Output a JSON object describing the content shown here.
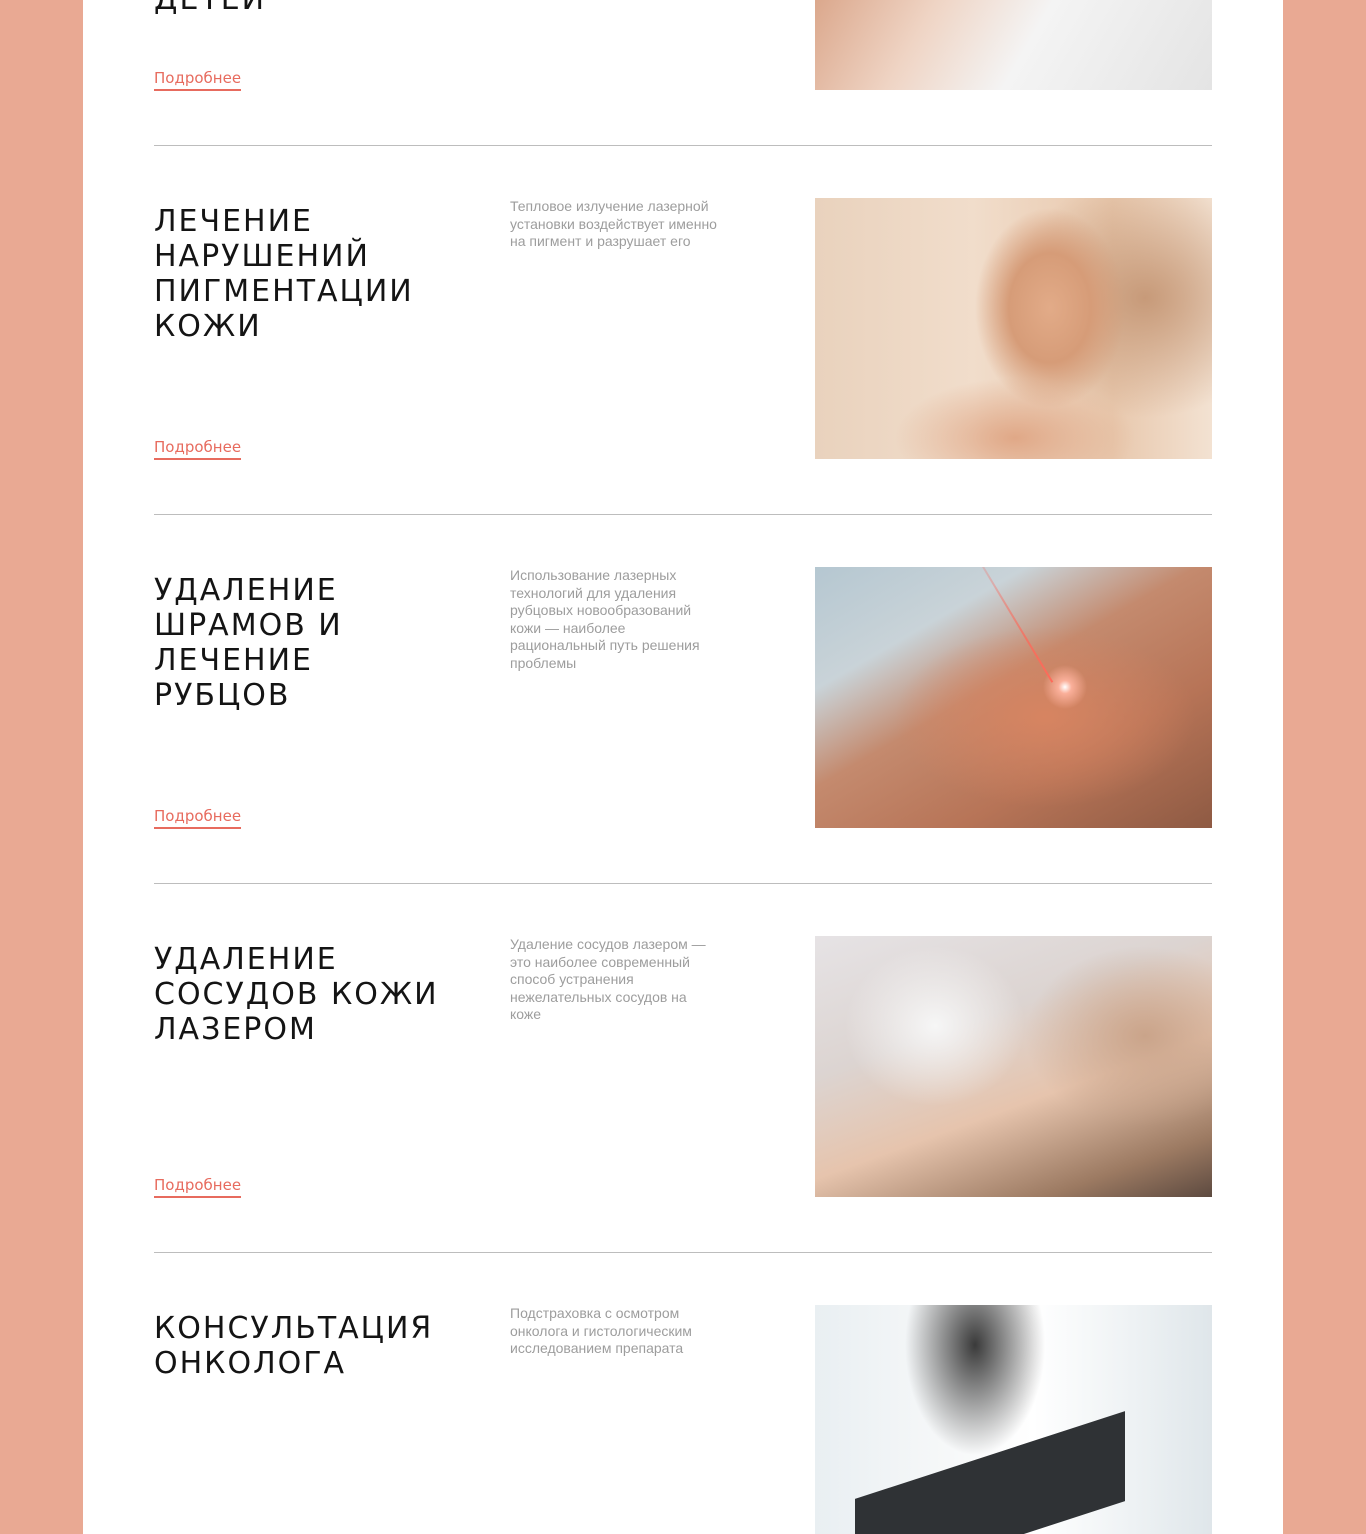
{
  "services": [
    {
      "title": "ДЕТЕЙ",
      "more_label": "Подробнее",
      "image": "skin-treatment-photo"
    },
    {
      "title": "ЛЕЧЕНИЕ НАРУШЕНИЙ ПИГМЕНТАЦИИ КОЖИ",
      "description": "Тепловое излучение лазерной установки воздействует именно на пигмент и разрушает его",
      "more_label": "Подробнее",
      "image": "freckled-woman-photo"
    },
    {
      "title": "УДАЛЕНИЕ ШРАМОВ И ЛЕЧЕНИЕ РУБЦОВ",
      "description": "Использование лазерных технологий для удаления рубцовых новообразований кожи  — наиболее рациональный путь решения проблемы",
      "more_label": "Подробнее",
      "image": "laser-scar-photo"
    },
    {
      "title": "УДАЛЕНИЕ СОСУДОВ КОЖИ ЛАЗЕРОМ",
      "description": "Удаление сосудов лазером — это наиболее современный способ устранения нежелательных сосудов на коже",
      "more_label": "Подробнее",
      "image": "laser-vessels-photo"
    },
    {
      "title": "КОНСУЛЬТАЦИЯ ОНКОЛОГА",
      "description": "Подстраховка с осмотром онколога и гистологическим исследованием препарата",
      "image": "doctor-photo"
    }
  ],
  "colors": {
    "side_background": "#e9a993",
    "accent": "#e76b5e",
    "title_text": "#141414",
    "description_text": "#9d9d9d",
    "divider": "#bdbdbd"
  }
}
